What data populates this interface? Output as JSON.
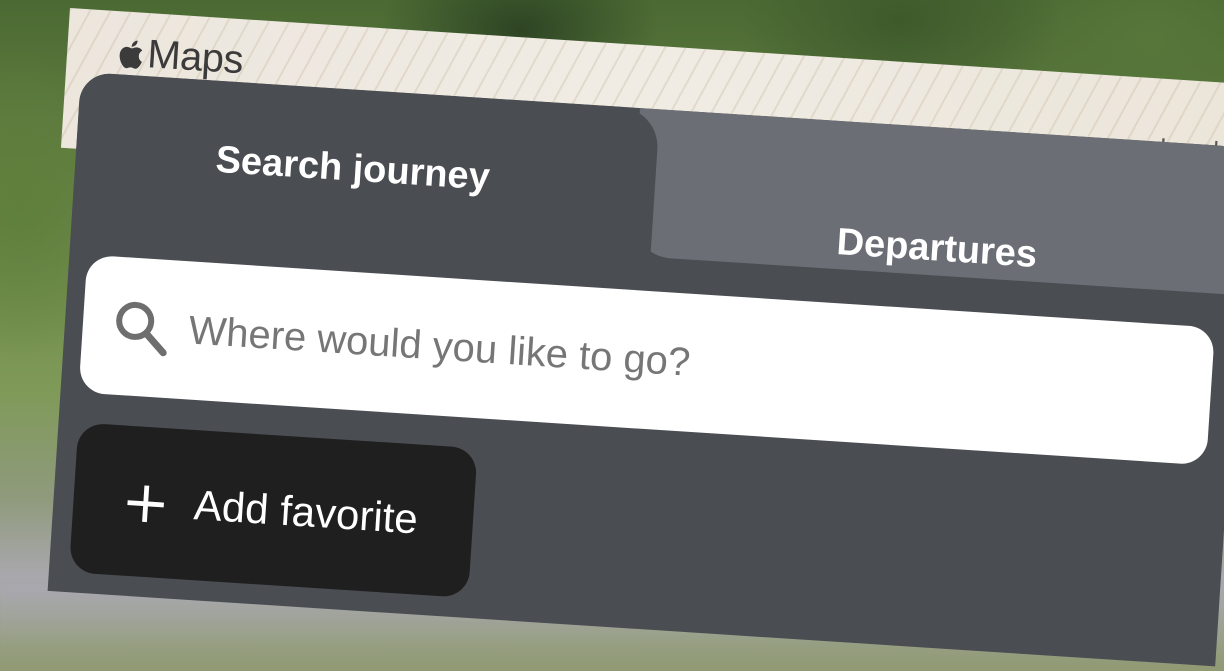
{
  "map": {
    "brand": "Maps",
    "legal_link": "Legal"
  },
  "tabs": [
    {
      "label": "Search journey",
      "active": true
    },
    {
      "label": "Departures",
      "active": false
    }
  ],
  "search": {
    "placeholder": "Where would you like to go?",
    "value": "",
    "icon": "search-icon"
  },
  "favorites": {
    "add_label": "Add favorite",
    "icon": "plus-icon"
  },
  "colors": {
    "panel": "#4a4d52",
    "inactive_tab": "#6b6e74",
    "button": "#1f1f20",
    "input_bg": "#ffffff"
  }
}
